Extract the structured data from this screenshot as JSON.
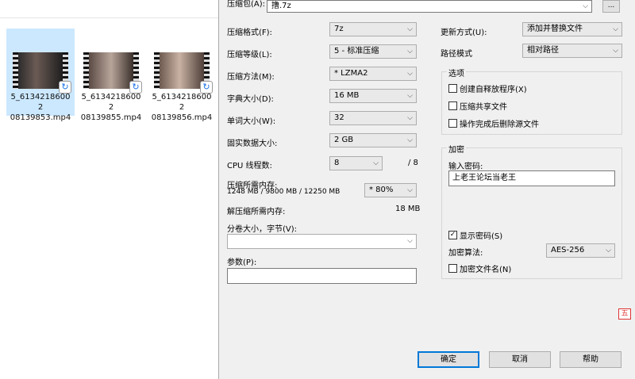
{
  "files": [
    {
      "name": "5_6134218600208139853.mp4",
      "line1": "5_61342186002",
      "line2": "08139853.mp4",
      "selected": true
    },
    {
      "name": "5_6134218600208139855.mp4",
      "line1": "5_61342186002",
      "line2": "08139855.mp4",
      "selected": false
    },
    {
      "name": "5_6134218600208139856.mp4",
      "line1": "5_61342186002",
      "line2": "08139856.mp4",
      "selected": false
    }
  ],
  "dialog": {
    "archive_label": "压缩包(A):",
    "archive_value": "撸.7z",
    "browse_label": "...",
    "format_label": "压缩格式(F):",
    "format_value": "7z",
    "level_label": "压缩等级(L):",
    "level_value": "5 - 标准压缩",
    "method_label": "压缩方法(M):",
    "method_value": "* LZMA2",
    "dict_label": "字典大小(D):",
    "dict_value": "16 MB",
    "word_label": "单词大小(W):",
    "word_value": "32",
    "solid_label": "固实数据大小:",
    "solid_value": "2 GB",
    "threads_label": "CPU 线程数:",
    "threads_value": "8",
    "threads_total": "/ 8",
    "mem_label": "压缩所需内存:",
    "mem_detail": "1248 MB / 9800 MB / 12250 MB",
    "mem_value": "* 80%",
    "decomp_label": "解压缩所需内存:",
    "decomp_value": "18 MB",
    "volume_label": "分卷大小，字节(V):",
    "volume_value": "",
    "params_label": "参数(P):",
    "params_value": "",
    "update_label": "更新方式(U):",
    "update_value": "添加并替换文件",
    "path_label": "路径模式",
    "path_value": "相对路径",
    "options_title": "选项",
    "opt_sfx": "创建自释放程序(X)",
    "opt_shared": "压缩共享文件",
    "opt_delete": "操作完成后删除源文件",
    "encrypt_title": "加密",
    "password_label": "输入密码:",
    "password_value": "上老王论坛当老王",
    "show_password": "显示密码(S)",
    "enc_method_label": "加密算法:",
    "enc_method_value": "AES-256",
    "enc_names": "加密文件名(N)",
    "ok": "确定",
    "cancel": "取消",
    "help": "帮助"
  },
  "tray_char": "五"
}
